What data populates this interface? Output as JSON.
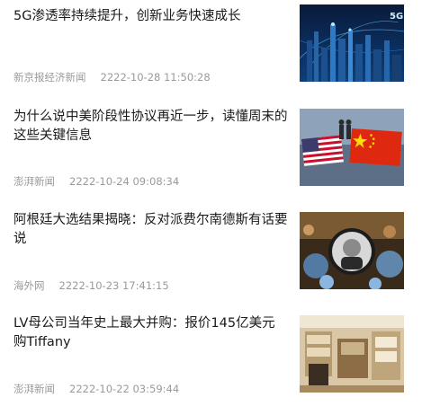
{
  "news": [
    {
      "title": "5G渗透率持续提升，创新业务快速成长",
      "source": "新京报经济新闻",
      "time": "2222-10-28 11:50:28",
      "image": "5g-city-image"
    },
    {
      "title": "为什么说中美阶段性协议再近一步，读懂周末的这些关键信息",
      "source": "澎湃新闻",
      "time": "2222-10-24 09:08:34",
      "image": "us-china-flags-image"
    },
    {
      "title": "阿根廷大选结果揭晓：反对派费尔南德斯有话要说",
      "source": "海外网",
      "time": "2222-10-23 17:41:15",
      "image": "argentina-rally-image"
    },
    {
      "title": "LV母公司当年史上最大并购：报价145亿美元购Tiffany",
      "source": "澎湃新闻",
      "time": "2222-10-22 03:59:44",
      "image": "tiffany-store-image"
    }
  ]
}
